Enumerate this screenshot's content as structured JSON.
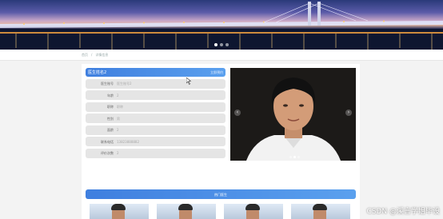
{
  "banner": {
    "slides": 3,
    "active_slide": 1
  },
  "breadcrumb": {
    "home": "首页",
    "separator": "/",
    "current": "详情信息"
  },
  "doctor": {
    "name": "医生姓名2",
    "action_link": "立即预约",
    "fields": [
      {
        "label": "医生账号",
        "value": "医生账号2"
      },
      {
        "label": "年龄",
        "value": "2"
      },
      {
        "label": "职称",
        "value": "职称"
      },
      {
        "label": "性别",
        "value": "男"
      },
      {
        "label": "面龄",
        "value": "2"
      },
      {
        "label": "联系电话",
        "value": "13823888882"
      },
      {
        "label": "评价次数",
        "value": "2"
      }
    ]
  },
  "photo": {
    "prev_icon": "chevron-left-icon",
    "next_icon": "chevron-right-icon",
    "slides": 3,
    "active_slide": 1
  },
  "popular": {
    "title": "热门医生"
  },
  "watermark": "CSDN @溪言学姐毕设",
  "colors": {
    "accent": "#3f7fdf",
    "row_bg": "#e5e5e5"
  }
}
